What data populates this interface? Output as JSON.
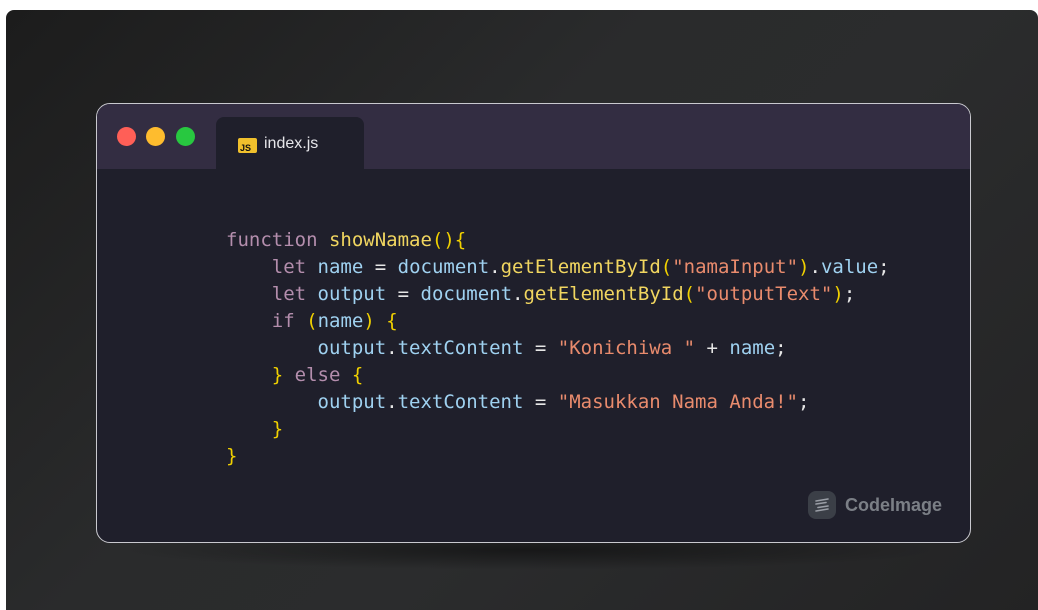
{
  "tab": {
    "label": "index.js",
    "icon": "js-file-icon",
    "icon_text": "JS",
    "icon_color": "#f0c02c"
  },
  "window_controls": [
    "close-light",
    "minimize-light",
    "maximize-light"
  ],
  "code_lines": [
    [
      {
        "t": "function",
        "c": "kw"
      },
      {
        "t": " ",
        "c": "pl"
      },
      {
        "t": "showNamae",
        "c": "fn"
      },
      {
        "t": "(){",
        "c": "br"
      }
    ],
    [
      {
        "t": "    ",
        "c": "pl"
      },
      {
        "t": "let",
        "c": "kw"
      },
      {
        "t": " ",
        "c": "pl"
      },
      {
        "t": "name",
        "c": "id"
      },
      {
        "t": " = ",
        "c": "pl"
      },
      {
        "t": "document",
        "c": "id"
      },
      {
        "t": ".",
        "c": "pl"
      },
      {
        "t": "getElementById",
        "c": "fn"
      },
      {
        "t": "(",
        "c": "br"
      },
      {
        "t": "\"namaInput\"",
        "c": "str"
      },
      {
        "t": ")",
        "c": "br"
      },
      {
        "t": ".",
        "c": "pl"
      },
      {
        "t": "value",
        "c": "id"
      },
      {
        "t": ";",
        "c": "pl"
      }
    ],
    [
      {
        "t": "    ",
        "c": "pl"
      },
      {
        "t": "let",
        "c": "kw"
      },
      {
        "t": " ",
        "c": "pl"
      },
      {
        "t": "output",
        "c": "id"
      },
      {
        "t": " = ",
        "c": "pl"
      },
      {
        "t": "document",
        "c": "id"
      },
      {
        "t": ".",
        "c": "pl"
      },
      {
        "t": "getElementById",
        "c": "fn"
      },
      {
        "t": "(",
        "c": "br"
      },
      {
        "t": "\"outputText\"",
        "c": "str"
      },
      {
        "t": ")",
        "c": "br"
      },
      {
        "t": ";",
        "c": "pl"
      }
    ],
    [
      {
        "t": "    ",
        "c": "pl"
      },
      {
        "t": "if",
        "c": "kw"
      },
      {
        "t": " ",
        "c": "pl"
      },
      {
        "t": "(",
        "c": "br"
      },
      {
        "t": "name",
        "c": "id"
      },
      {
        "t": ")",
        "c": "br"
      },
      {
        "t": " ",
        "c": "pl"
      },
      {
        "t": "{",
        "c": "br"
      }
    ],
    [
      {
        "t": "        ",
        "c": "pl"
      },
      {
        "t": "output",
        "c": "id"
      },
      {
        "t": ".",
        "c": "pl"
      },
      {
        "t": "textContent",
        "c": "id"
      },
      {
        "t": " = ",
        "c": "pl"
      },
      {
        "t": "\"Konichiwa \"",
        "c": "str"
      },
      {
        "t": " + ",
        "c": "pl"
      },
      {
        "t": "name",
        "c": "id"
      },
      {
        "t": ";",
        "c": "pl"
      }
    ],
    [
      {
        "t": "    ",
        "c": "pl"
      },
      {
        "t": "}",
        "c": "br"
      },
      {
        "t": " ",
        "c": "pl"
      },
      {
        "t": "else",
        "c": "kw"
      },
      {
        "t": " ",
        "c": "pl"
      },
      {
        "t": "{",
        "c": "br"
      }
    ],
    [
      {
        "t": "        ",
        "c": "pl"
      },
      {
        "t": "output",
        "c": "id"
      },
      {
        "t": ".",
        "c": "pl"
      },
      {
        "t": "textContent",
        "c": "id"
      },
      {
        "t": " = ",
        "c": "pl"
      },
      {
        "t": "\"Masukkan Nama Anda!\"",
        "c": "str"
      },
      {
        "t": ";",
        "c": "pl"
      }
    ],
    [
      {
        "t": "    ",
        "c": "pl"
      },
      {
        "t": "}",
        "c": "br"
      }
    ],
    [
      {
        "t": "}",
        "c": "br"
      }
    ]
  ],
  "watermark": {
    "label": "CodeImage",
    "icon": "codeimage-logo-icon"
  },
  "colors": {
    "keyword": "#b48ead",
    "function": "#f1d660",
    "bracket": "#f0d000",
    "string": "#e98b6d",
    "identifier": "#9fd1f0",
    "plain": "#e6e6e6",
    "editor_bg": "#1f1f2b",
    "titlebar_bg": "#332d42"
  }
}
